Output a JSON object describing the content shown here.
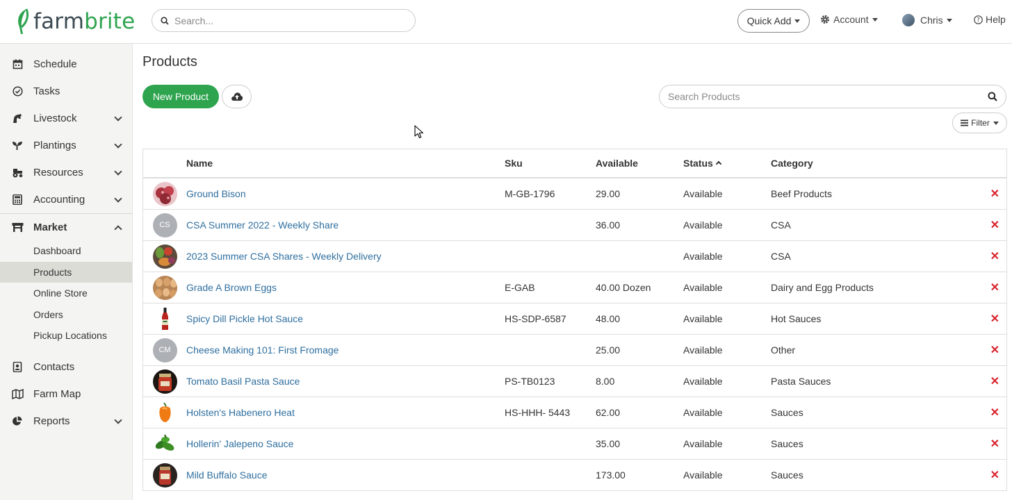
{
  "header": {
    "logo_text_a": "farm",
    "logo_text_b": "brite",
    "search_placeholder": "Search...",
    "quick_add": "Quick Add",
    "account": "Account",
    "user": "Chris",
    "help": "Help"
  },
  "sidebar": {
    "items": [
      {
        "label": "Schedule",
        "icon": "calendar-icon"
      },
      {
        "label": "Tasks",
        "icon": "check-circle-icon"
      },
      {
        "label": "Livestock",
        "icon": "horse-icon"
      },
      {
        "label": "Plantings",
        "icon": "seedling-icon"
      },
      {
        "label": "Resources",
        "icon": "tractor-icon"
      },
      {
        "label": "Accounting",
        "icon": "calculator-icon"
      },
      {
        "label": "Market",
        "icon": "store-icon"
      },
      {
        "label": "Contacts",
        "icon": "address-book-icon"
      },
      {
        "label": "Farm Map",
        "icon": "map-icon"
      },
      {
        "label": "Reports",
        "icon": "pie-chart-icon"
      }
    ],
    "market_sub": [
      "Dashboard",
      "Products",
      "Online Store",
      "Orders",
      "Pickup Locations"
    ],
    "active_sub": "Products"
  },
  "main": {
    "title": "Products",
    "new_product": "New Product",
    "search_placeholder": "Search Products",
    "filter": "Filter"
  },
  "table": {
    "headers": {
      "name": "Name",
      "sku": "Sku",
      "available": "Available",
      "status": "Status",
      "category": "Category"
    },
    "rows": [
      {
        "name": "Ground Bison",
        "sku": "M-GB-1796",
        "available": "29.00",
        "status": "Available",
        "category": "Beef Products",
        "thumb": "bison-meat-image",
        "initials": ""
      },
      {
        "name": "CSA Summer 2022 - Weekly Share",
        "sku": "",
        "available": "36.00",
        "status": "Available",
        "category": "CSA",
        "thumb": "",
        "initials": "CS"
      },
      {
        "name": "2023 Summer CSA Shares - Weekly Delivery",
        "sku": "",
        "available": "",
        "status": "Available",
        "category": "CSA",
        "thumb": "vegetables-image",
        "initials": ""
      },
      {
        "name": "Grade A Brown Eggs",
        "sku": "E-GAB",
        "available": "40.00 Dozen",
        "status": "Available",
        "category": "Dairy and Egg Products",
        "thumb": "eggs-image",
        "initials": ""
      },
      {
        "name": "Spicy Dill Pickle Hot Sauce",
        "sku": "HS-SDP-6587",
        "available": "48.00",
        "status": "Available",
        "category": "Hot Sauces",
        "thumb": "hot-sauce-bottle-image",
        "initials": ""
      },
      {
        "name": "Cheese Making 101: First Fromage",
        "sku": "",
        "available": "25.00",
        "status": "Available",
        "category": "Other",
        "thumb": "",
        "initials": "CM"
      },
      {
        "name": "Tomato Basil Pasta Sauce",
        "sku": "PS-TB0123",
        "available": "8.00",
        "status": "Available",
        "category": "Pasta Sauces",
        "thumb": "pasta-sauce-jar-image",
        "initials": ""
      },
      {
        "name": "Holsten's Habenero Heat",
        "sku": "HS-HHH- 5443",
        "available": "62.00",
        "status": "Available",
        "category": "Sauces",
        "thumb": "habanero-image",
        "initials": ""
      },
      {
        "name": "Hollerin' Jalepeno Sauce",
        "sku": "",
        "available": "35.00",
        "status": "Available",
        "category": "Sauces",
        "thumb": "jalapeno-image",
        "initials": ""
      },
      {
        "name": "Mild Buffalo Sauce",
        "sku": "",
        "available": "173.00",
        "status": "Available",
        "category": "Sauces",
        "thumb": "buffalo-sauce-jar-image",
        "initials": ""
      }
    ]
  },
  "colors": {
    "brand_green": "#2ea44f",
    "link_blue": "#2f6f9f",
    "delete_red": "#d9232d"
  }
}
